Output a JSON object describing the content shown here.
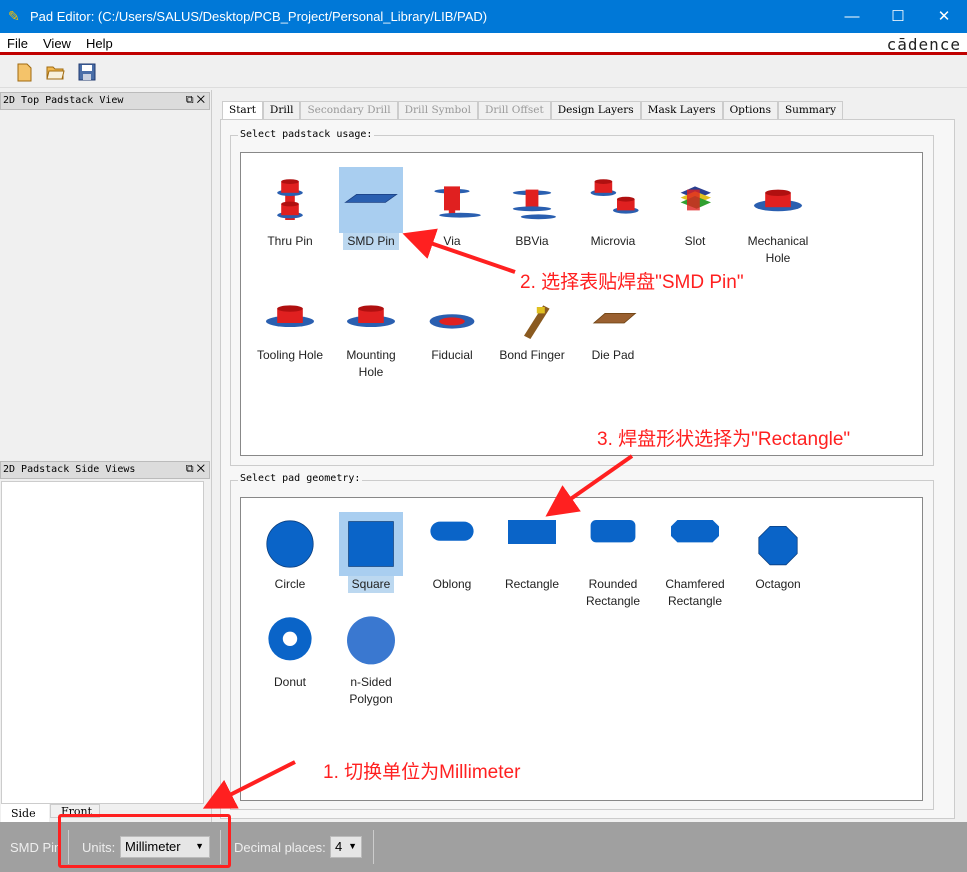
{
  "window": {
    "title": "Pad Editor:   (C:/Users/SALUS/Desktop/PCB_Project/Personal_Library/LIB/PAD)",
    "minimize": "—",
    "maximize": "☐",
    "close": "✕"
  },
  "menu": {
    "items": [
      "File",
      "View",
      "Help"
    ],
    "logo": "cādence"
  },
  "toolbar": {
    "icons": [
      "new-file-icon",
      "open-folder-icon",
      "save-icon"
    ]
  },
  "left_panels": {
    "top_title": "2D Top Padstack View",
    "side_title": "2D Padstack Side Views",
    "tabs": [
      "Side",
      "Front"
    ]
  },
  "tabs": [
    {
      "label": "Start",
      "active": true
    },
    {
      "label": "Drill"
    },
    {
      "label": "Secondary Drill",
      "disabled": true
    },
    {
      "label": "Drill Symbol",
      "disabled": true
    },
    {
      "label": "Drill Offset",
      "disabled": true
    },
    {
      "label": "Design Layers"
    },
    {
      "label": "Mask Layers"
    },
    {
      "label": "Options"
    },
    {
      "label": "Summary"
    }
  ],
  "usage": {
    "title": "Select padstack usage:",
    "items": [
      {
        "label": "Thru Pin",
        "icon": "thru-pin"
      },
      {
        "label": "SMD Pin",
        "icon": "smd-pin",
        "selected": true
      },
      {
        "label": "Via",
        "icon": "via"
      },
      {
        "label": "BBVia",
        "icon": "bbvia"
      },
      {
        "label": "Microvia",
        "icon": "microvia"
      },
      {
        "label": "Slot",
        "icon": "slot"
      },
      {
        "label": "Mechanical Hole",
        "icon": "mechanical-hole"
      },
      {
        "label": "Tooling Hole",
        "icon": "tooling-hole"
      },
      {
        "label": "Mounting Hole",
        "icon": "mounting-hole"
      },
      {
        "label": "Fiducial",
        "icon": "fiducial"
      },
      {
        "label": "Bond Finger",
        "icon": "bond-finger"
      },
      {
        "label": "Die Pad",
        "icon": "die-pad"
      }
    ]
  },
  "geometry": {
    "title": "Select pad geometry:",
    "items": [
      {
        "label": "Circle",
        "icon": "circle"
      },
      {
        "label": "Square",
        "icon": "square",
        "selected": true
      },
      {
        "label": "Oblong",
        "icon": "oblong"
      },
      {
        "label": "Rectangle",
        "icon": "rectangle"
      },
      {
        "label": "Rounded Rectangle",
        "icon": "rounded-rectangle"
      },
      {
        "label": "Chamfered Rectangle",
        "icon": "chamfered-rectangle"
      },
      {
        "label": "Octagon",
        "icon": "octagon"
      },
      {
        "label": "Donut",
        "icon": "donut"
      },
      {
        "label": "n-Sided Polygon",
        "icon": "n-sided-polygon"
      }
    ]
  },
  "status": {
    "usage": "SMD Pin",
    "units_label": "Units:",
    "units_value": "Millimeter",
    "decimal_label": "Decimal places:",
    "decimal_value": "4"
  },
  "annotations": [
    "1. 切换单位为Millimeter",
    "2. 选择表贴焊盘\"SMD Pin\"",
    "3. 焊盘形状选择为\"Rectangle\""
  ],
  "colors": {
    "titlebar": "#0078d7",
    "annotation": "#ff2020",
    "pad": "#0a64c8"
  }
}
